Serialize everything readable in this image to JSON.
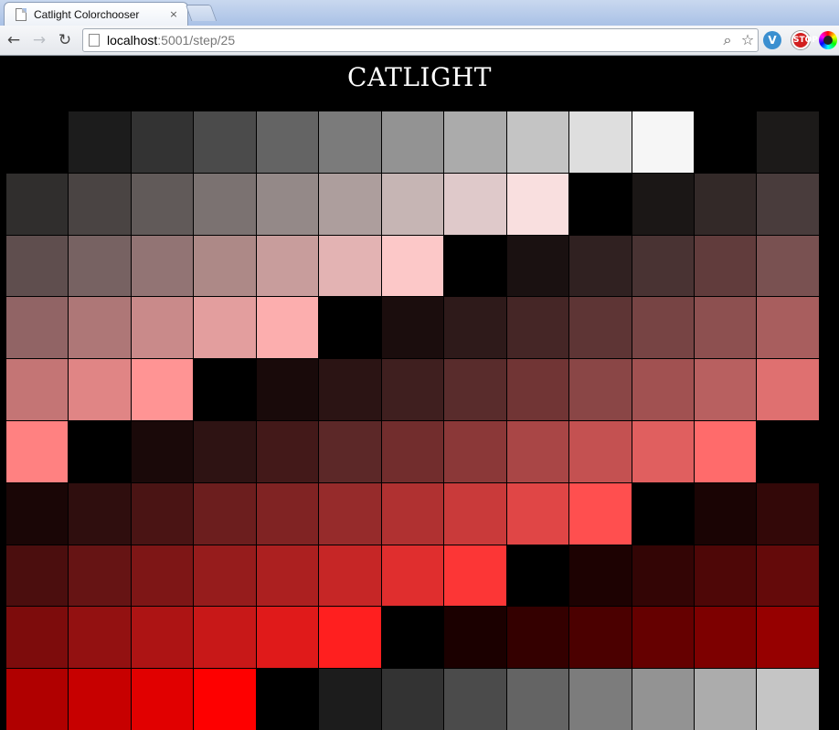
{
  "tab": {
    "title": "Catlight Colorchooser",
    "close": "×"
  },
  "toolbar": {
    "back": "←",
    "forward": "→",
    "reload": "↻",
    "url_host": "localhost",
    "url_path": ":5001/step/25",
    "zoom_icon": "⌕",
    "bookmark_star": "☆",
    "ext_v": "V",
    "ext_stop": "STOP"
  },
  "page": {
    "title": "CATLIGHT"
  },
  "swatches": [
    "#000000",
    "#1c1c1c",
    "#333333",
    "#4b4b4b",
    "#646464",
    "#7b7b7b",
    "#939393",
    "#ababab",
    "#c4c4c4",
    "#dedede",
    "#f6f6f6",
    "#000000",
    "#1c1a19",
    "#302e2d",
    "#4a4443",
    "#615a59",
    "#7b7271",
    "#948988",
    "#ad9e9d",
    "#c6b5b4",
    "#dfc9ca",
    "#f9dfdf",
    "#000000",
    "#1b1716",
    "#332928",
    "#493c3c",
    "#5f4e4e",
    "#776262",
    "#927474",
    "#ad8987",
    "#c89d9c",
    "#e3b3b3",
    "#fcc8c8",
    "#000000",
    "#1a1111",
    "#302121",
    "#493333",
    "#613c3c",
    "#795151",
    "#916465",
    "#ae7777",
    "#c98a8a",
    "#e39e9e",
    "#fcaeae",
    "#000000",
    "#1b0d0d",
    "#2e1a1a",
    "#452626",
    "#5e3535",
    "#774444",
    "#8d5050",
    "#a85e5e",
    "#c47575",
    "#e08585",
    "#ff9494",
    "#000000",
    "#190a0a",
    "#2b1414",
    "#3f1f1f",
    "#592c2c",
    "#713535",
    "#8a4646",
    "#a15151",
    "#b86060",
    "#df7070",
    "#ff8181",
    "#000000",
    "#1a0909",
    "#2e1313",
    "#431919",
    "#5c2828",
    "#722d2d",
    "#8b3838",
    "#a94646",
    "#c45151",
    "#e05f5f",
    "#ff6b6b",
    "#000000",
    "#1a0606",
    "#2f0e0e",
    "#4a1414",
    "#6c1e1e",
    "#802323",
    "#962b2b",
    "#b03131",
    "#c93a3a",
    "#e04646",
    "#ff4f4f",
    "#000000",
    "#1a0404",
    "#330808",
    "#4b0e0e",
    "#661414",
    "#7e1616",
    "#961c1c",
    "#ac2020",
    "#c62626",
    "#e02e2e",
    "#fc3636",
    "#000000",
    "#1d0202",
    "#330505",
    "#4e0707",
    "#640a0a",
    "#7d0c0c",
    "#931111",
    "#ad1414",
    "#c81818",
    "#e01a1a",
    "#ff1f1f",
    "#000000",
    "#1b0000",
    "#340000",
    "#4b0000",
    "#650000",
    "#7d0000",
    "#960000",
    "#b00000",
    "#c70000",
    "#e10000",
    "#fe0000",
    "#000000",
    "#1c1c1c",
    "#333333",
    "#4b4b4b",
    "#646464",
    "#7c7c7c",
    "#939393",
    "#acacac",
    "#c5c5c5"
  ]
}
